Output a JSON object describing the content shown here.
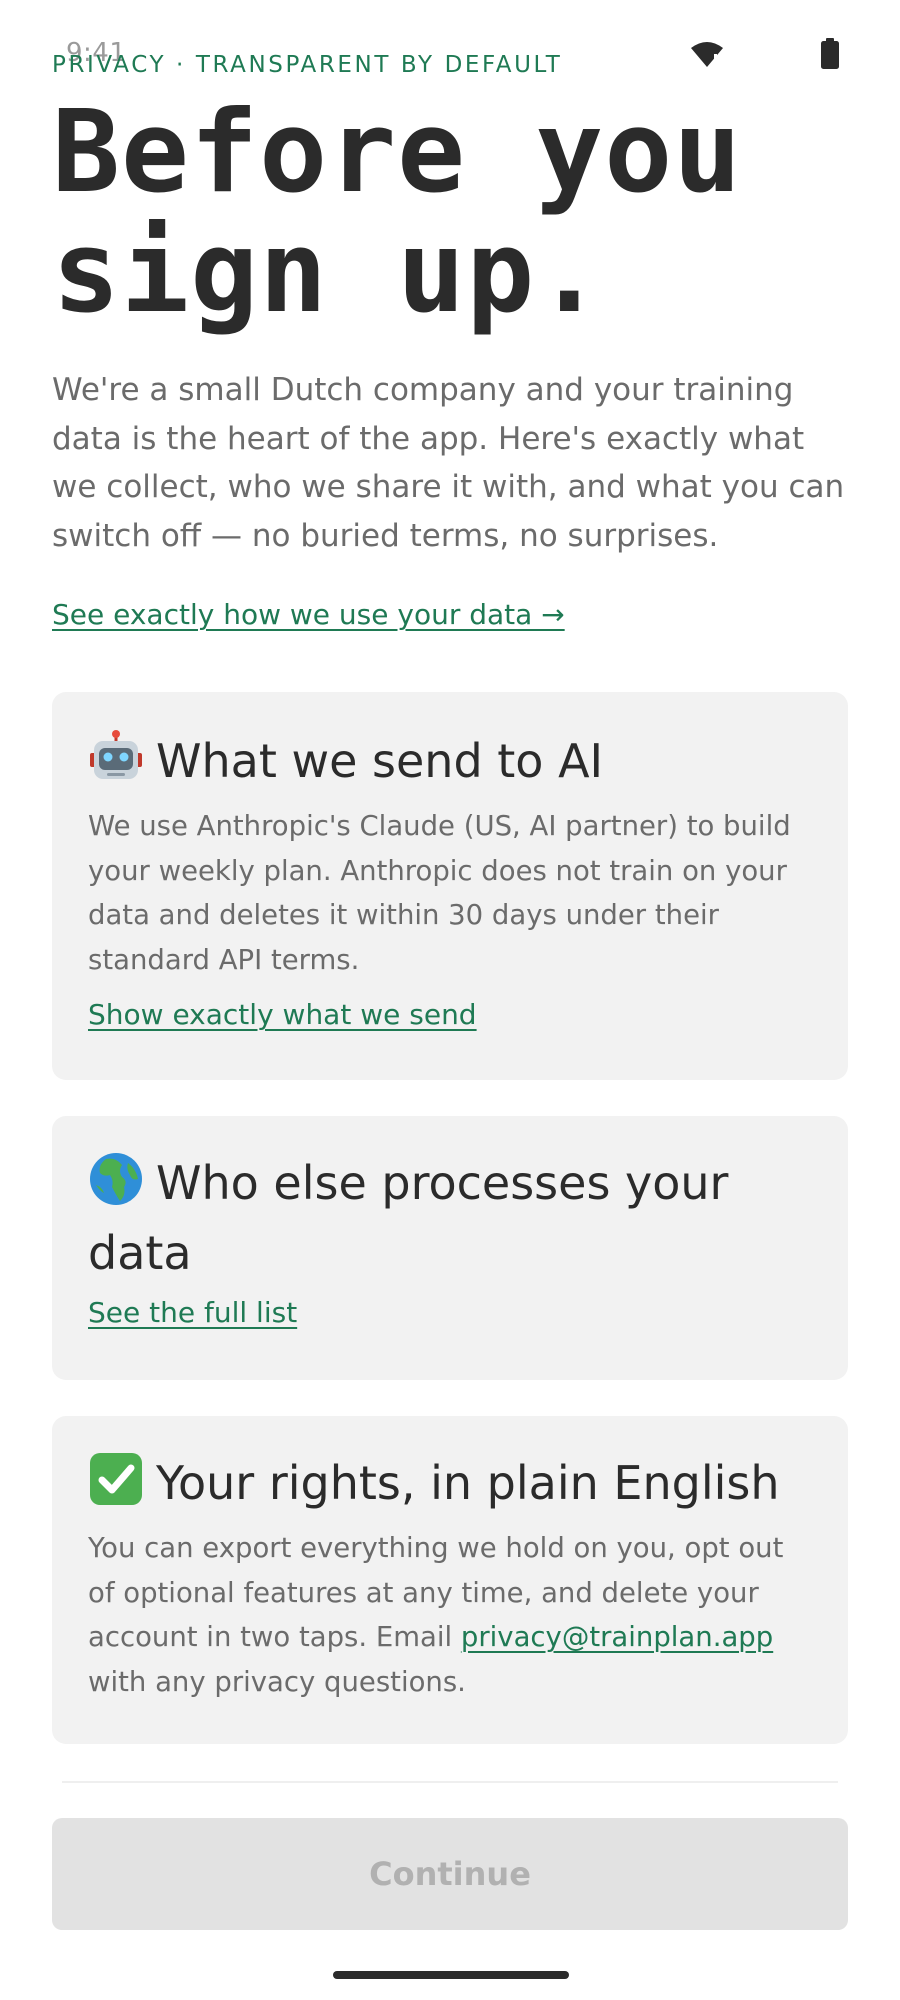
{
  "status_bar": {
    "time": "9:41",
    "icons": [
      "wifi-icon",
      "battery-icon"
    ]
  },
  "header": {
    "eyebrow": "PRIVACY · TRANSPARENT BY DEFAULT",
    "title_line1": "Before you",
    "title_line2": "sign up.",
    "intro": "We're a small Dutch company and your training data is the heart of the app. Here's exactly what we collect, who we share it with, and what you can switch off — no buried terms, no surprises.",
    "data_link": "See exactly how we use your data →"
  },
  "cards": {
    "ai": {
      "icon": "robot-icon",
      "title": "What we send to AI",
      "body": "We use Anthropic's Claude (US, AI partner) to build your weekly plan. Anthropic does not train on your data and deletes it within 30 days under their standard API terms.",
      "link": "Show exactly what we send"
    },
    "processors": {
      "icon": "globe-icon",
      "title": "Who else processes your data",
      "link": "See the full list"
    },
    "rights": {
      "icon": "check-mark-icon",
      "title": "Your rights, in plain English",
      "body_before": "You can export everything we hold on you, opt out of optional features at any time, and delete your account in two taps. Email ",
      "email": "privacy@trainplan.app",
      "body_after": " with any privacy questions."
    }
  },
  "footer": {
    "continue_label": "Continue",
    "continue_enabled": false
  },
  "colors": {
    "accent": "#1f7a54",
    "heading": "#2b2b2b",
    "body_text": "#6b6b6b",
    "card_background": "#f2f2f2",
    "button_disabled_bg": "#e2e2e2",
    "button_disabled_text": "#b1b1b1"
  }
}
